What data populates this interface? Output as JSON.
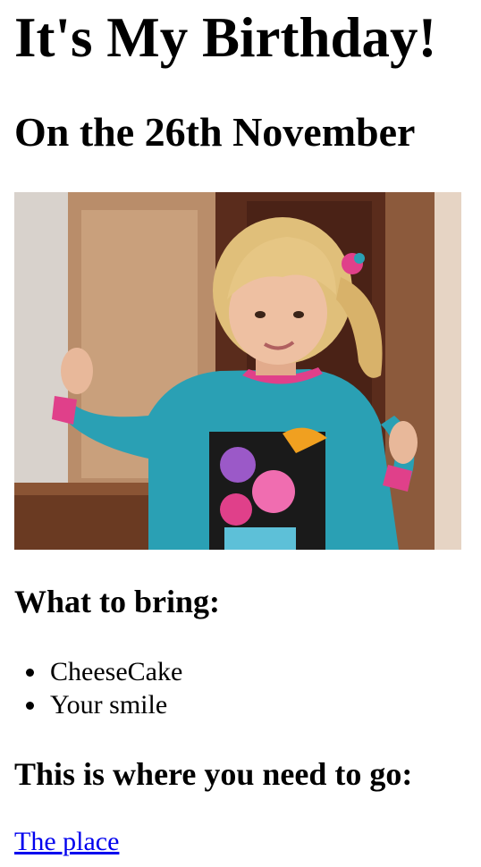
{
  "title": "It's My Birthday!",
  "date": "On the 26th November",
  "bring": {
    "heading": "What to bring:",
    "items": [
      "CheeseCake",
      "Your smile"
    ]
  },
  "directions": {
    "heading": "This is where you need to go:",
    "link_label": "The place"
  },
  "colors": {
    "link": "#0000ee",
    "text": "#000000",
    "background": "#ffffff"
  }
}
